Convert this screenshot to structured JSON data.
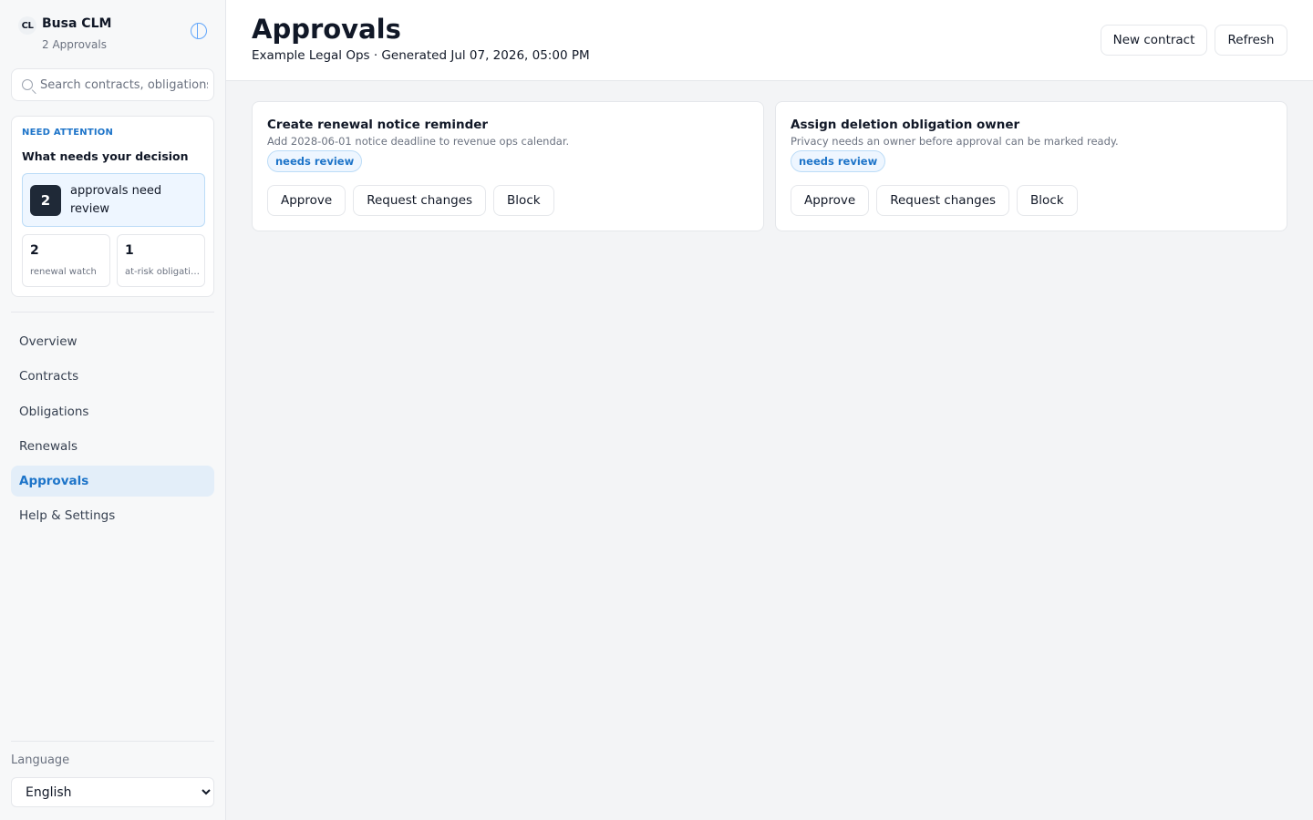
{
  "brand": {
    "logo": "CL",
    "name": "Busa CLM",
    "subtitle": "2 Approvals"
  },
  "search": {
    "placeholder": "Search contracts, obligations"
  },
  "attention": {
    "eyebrow": "NEED ATTENTION",
    "title": "What needs your decision",
    "primary": {
      "count": "2",
      "label": "approvals need review"
    },
    "minis": [
      {
        "count": "2",
        "label": "renewal watch"
      },
      {
        "count": "1",
        "label": "at-risk obligations"
      }
    ]
  },
  "nav": [
    {
      "label": "Overview",
      "active": false
    },
    {
      "label": "Contracts",
      "active": false
    },
    {
      "label": "Obligations",
      "active": false
    },
    {
      "label": "Renewals",
      "active": false
    },
    {
      "label": "Approvals",
      "active": true
    },
    {
      "label": "Help & Settings",
      "active": false
    }
  ],
  "language": {
    "label": "Language",
    "selected": "English"
  },
  "header": {
    "title": "Approvals",
    "subtitle": "Example Legal Ops · Generated Jul 07, 2026, 05:00 PM",
    "new_contract": "New contract",
    "refresh": "Refresh"
  },
  "cards": [
    {
      "title": "Create renewal notice reminder",
      "description": "Add 2028-06-01 notice deadline to revenue ops calendar.",
      "status": "needs review",
      "actions": [
        "Approve",
        "Request changes",
        "Block"
      ]
    },
    {
      "title": "Assign deletion obligation owner",
      "description": "Privacy needs an owner before approval can be marked ready.",
      "status": "needs review",
      "actions": [
        "Approve",
        "Request changes",
        "Block"
      ]
    }
  ],
  "colors": {
    "accent": "#1d74c9",
    "badge_bg": "#eef6ff",
    "count_bg": "#1f2937"
  }
}
